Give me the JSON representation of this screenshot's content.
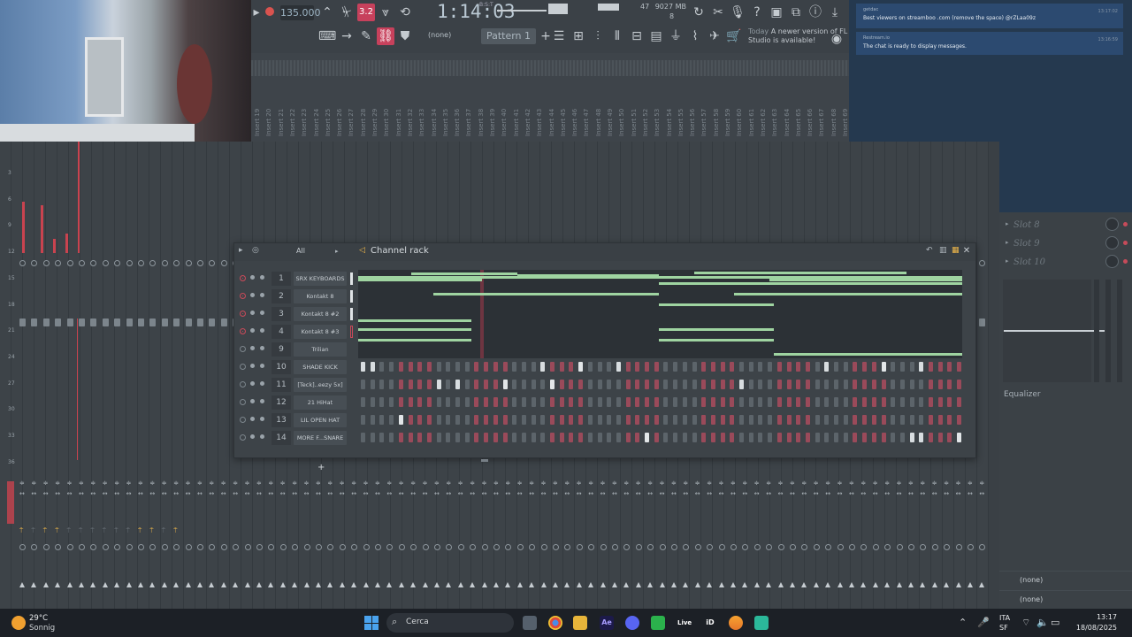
{
  "toolbar": {
    "tempo": "135.000",
    "time_main": "1:14:03",
    "time_small": "B:S:T",
    "memory_top": "47",
    "memory_mb": "9027 MB",
    "memory_bottom": "8",
    "pattern": "Pattern 1",
    "none_select": "(none)",
    "news_today": "Today",
    "news_text": "A newer version of FL Studio is available!",
    "accent": "#c7415c"
  },
  "inserts": [
    "Insert 19",
    "Insert 20",
    "Insert 21",
    "Insert 22",
    "Insert 23",
    "Insert 24",
    "Insert 25",
    "Insert 26",
    "Insert 27",
    "Insert 28",
    "Insert 29",
    "Insert 30",
    "Insert 31",
    "Insert 32",
    "Insert 33",
    "Insert 34",
    "Insert 35",
    "Insert 36",
    "Insert 37",
    "Insert 38",
    "Insert 39",
    "Insert 40",
    "Insert 41",
    "Insert 42",
    "Insert 43",
    "Insert 44",
    "Insert 45",
    "Insert 46",
    "Insert 47",
    "Insert 48",
    "Insert 49",
    "Insert 50",
    "Insert 51",
    "Insert 52",
    "Insert 53",
    "Insert 54",
    "Insert 55",
    "Insert 56",
    "Insert 57",
    "Insert 58",
    "Insert 59",
    "Insert 60",
    "Insert 61",
    "Insert 62",
    "Insert 63",
    "Insert 64",
    "Insert 65",
    "Insert 66",
    "Insert 67",
    "Insert 68",
    "Insert 69"
  ],
  "chat": {
    "messages": [
      {
        "name": "getdac",
        "text": "Best viewers on streamboo .com (remove the space) @rZLaa09z",
        "time": "13:17:02"
      },
      {
        "name": "Restream.io",
        "text": "The chat is ready to display messages.",
        "time": "13:16:59"
      }
    ]
  },
  "mixer": {
    "db_labels": [
      "3",
      "6",
      "9",
      "12",
      "15",
      "18",
      "21",
      "24",
      "27",
      "30",
      "33",
      "36"
    ]
  },
  "right_panel": {
    "slots": [
      "Slot 8",
      "Slot 9",
      "Slot 10"
    ],
    "equalizer": "Equalizer",
    "route_1": "(none)",
    "route_2": "(none)"
  },
  "channel_rack": {
    "title": "Channel rack",
    "filter": "All",
    "channels": [
      {
        "num": "1",
        "name": "SRX KEYBOARDS",
        "led": true
      },
      {
        "num": "2",
        "name": "Kontakt 8",
        "led": true
      },
      {
        "num": "3",
        "name": "Kontakt 8 #2",
        "led": true
      },
      {
        "num": "4",
        "name": "Kontakt 8 #3",
        "led": true
      },
      {
        "num": "9",
        "name": "Trilian",
        "led": false
      },
      {
        "num": "10",
        "name": "SHADE KICK",
        "led": false
      },
      {
        "num": "11",
        "name": "[Teck]..eezy 5x]",
        "led": false
      },
      {
        "num": "12",
        "name": "21 HiHat",
        "led": false
      },
      {
        "num": "13",
        "name": "LIL OPEN HAT",
        "led": false
      },
      {
        "num": "14",
        "name": "MORE F...SNARE",
        "led": false
      }
    ],
    "step_patterns": [
      [
        1,
        1,
        0,
        0,
        0,
        0,
        0,
        0,
        0,
        0,
        0,
        0,
        0,
        0,
        0,
        0,
        0,
        0,
        0,
        1,
        0,
        0,
        0,
        1,
        0,
        0,
        0,
        1,
        0,
        0,
        0,
        0,
        0,
        0,
        0,
        0,
        0,
        0,
        0,
        0,
        0,
        0,
        0,
        0,
        0,
        0,
        0,
        0,
        0,
        1,
        0,
        0,
        0,
        0,
        0,
        1,
        0,
        0,
        0,
        1,
        0,
        0,
        0,
        0
      ],
      [
        0,
        0,
        0,
        0,
        0,
        0,
        0,
        0,
        1,
        0,
        1,
        0,
        0,
        0,
        0,
        1,
        0,
        0,
        0,
        0,
        1,
        0,
        0,
        0,
        0,
        0,
        0,
        0,
        0,
        0,
        0,
        0,
        0,
        0,
        0,
        0,
        0,
        0,
        0,
        0,
        1,
        0,
        0,
        0,
        0,
        0,
        0,
        0,
        0,
        0,
        0,
        0,
        0,
        0,
        0,
        0,
        0,
        0,
        0,
        0,
        0,
        0,
        0,
        0
      ],
      [
        0,
        0,
        0,
        0,
        0,
        0,
        0,
        0,
        0,
        0,
        0,
        0,
        0,
        0,
        0,
        0,
        0,
        0,
        0,
        0,
        0,
        0,
        0,
        0,
        0,
        0,
        0,
        0,
        0,
        0,
        0,
        0,
        0,
        0,
        0,
        0,
        0,
        0,
        0,
        0,
        0,
        0,
        0,
        0,
        0,
        0,
        0,
        0,
        0,
        0,
        0,
        0,
        0,
        0,
        0,
        0,
        0,
        0,
        0,
        0,
        0,
        0,
        0,
        0
      ],
      [
        0,
        0,
        0,
        0,
        1,
        0,
        0,
        0,
        0,
        0,
        0,
        0,
        0,
        0,
        0,
        0,
        0,
        0,
        0,
        0,
        0,
        0,
        0,
        0,
        0,
        0,
        0,
        0,
        0,
        0,
        0,
        0,
        0,
        0,
        0,
        0,
        0,
        0,
        0,
        0,
        0,
        0,
        0,
        0,
        0,
        0,
        0,
        0,
        0,
        0,
        0,
        0,
        0,
        0,
        0,
        0,
        0,
        0,
        0,
        0,
        0,
        0,
        0,
        0
      ],
      [
        0,
        0,
        0,
        0,
        0,
        0,
        0,
        0,
        0,
        0,
        0,
        0,
        0,
        0,
        0,
        0,
        0,
        0,
        0,
        0,
        0,
        0,
        0,
        0,
        0,
        0,
        0,
        0,
        0,
        0,
        1,
        0,
        0,
        0,
        0,
        0,
        0,
        0,
        0,
        0,
        0,
        0,
        0,
        0,
        0,
        0,
        0,
        0,
        0,
        0,
        0,
        0,
        0,
        0,
        0,
        0,
        0,
        0,
        1,
        1,
        0,
        0,
        0,
        1
      ]
    ]
  },
  "taskbar": {
    "weather_temp": "29°C",
    "weather_desc": "Sonnig",
    "search": "Cerca",
    "lang_1": "ITA",
    "lang_2": "SF",
    "time": "13:17",
    "date": "18/08/2025"
  }
}
